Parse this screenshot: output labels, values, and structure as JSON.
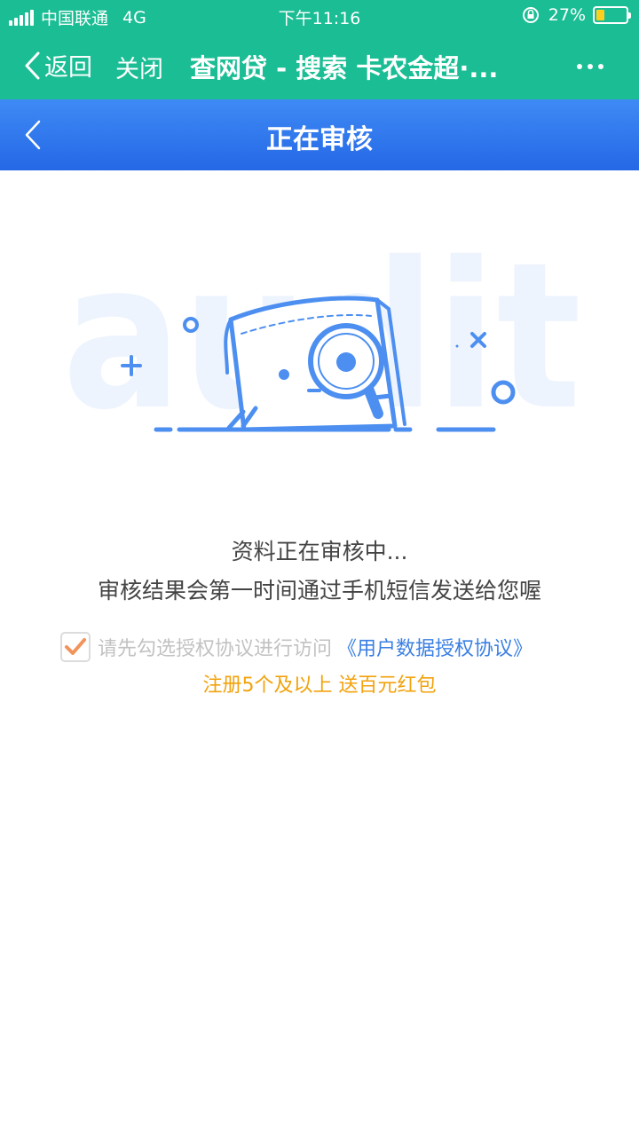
{
  "status_bar": {
    "carrier": "中国联通",
    "network": "4G",
    "time": "下午11:16",
    "battery": "27%",
    "battery_level": 0.27
  },
  "nav_bar": {
    "back_label": "返回",
    "close_label": "关闭",
    "title": "查网贷 - 搜索 卡农金超·..."
  },
  "page": {
    "title": "正在审核",
    "watermark": "audit",
    "message_line1": "资料正在审核中...",
    "message_line2": "审核结果会第一时间通过手机短信发送给您喔",
    "agree_text": "请先勾选授权协议进行访问",
    "agree_link": "《用户数据授权协议》",
    "agree_checked": true,
    "promo": "注册5个及以上 送百元红包"
  },
  "colors": {
    "status_bar": "#1bbd94",
    "header": "#2e74ee",
    "link": "#3a7fe3",
    "promo": "#f2a20c",
    "illustration": "#4d8ff0"
  }
}
